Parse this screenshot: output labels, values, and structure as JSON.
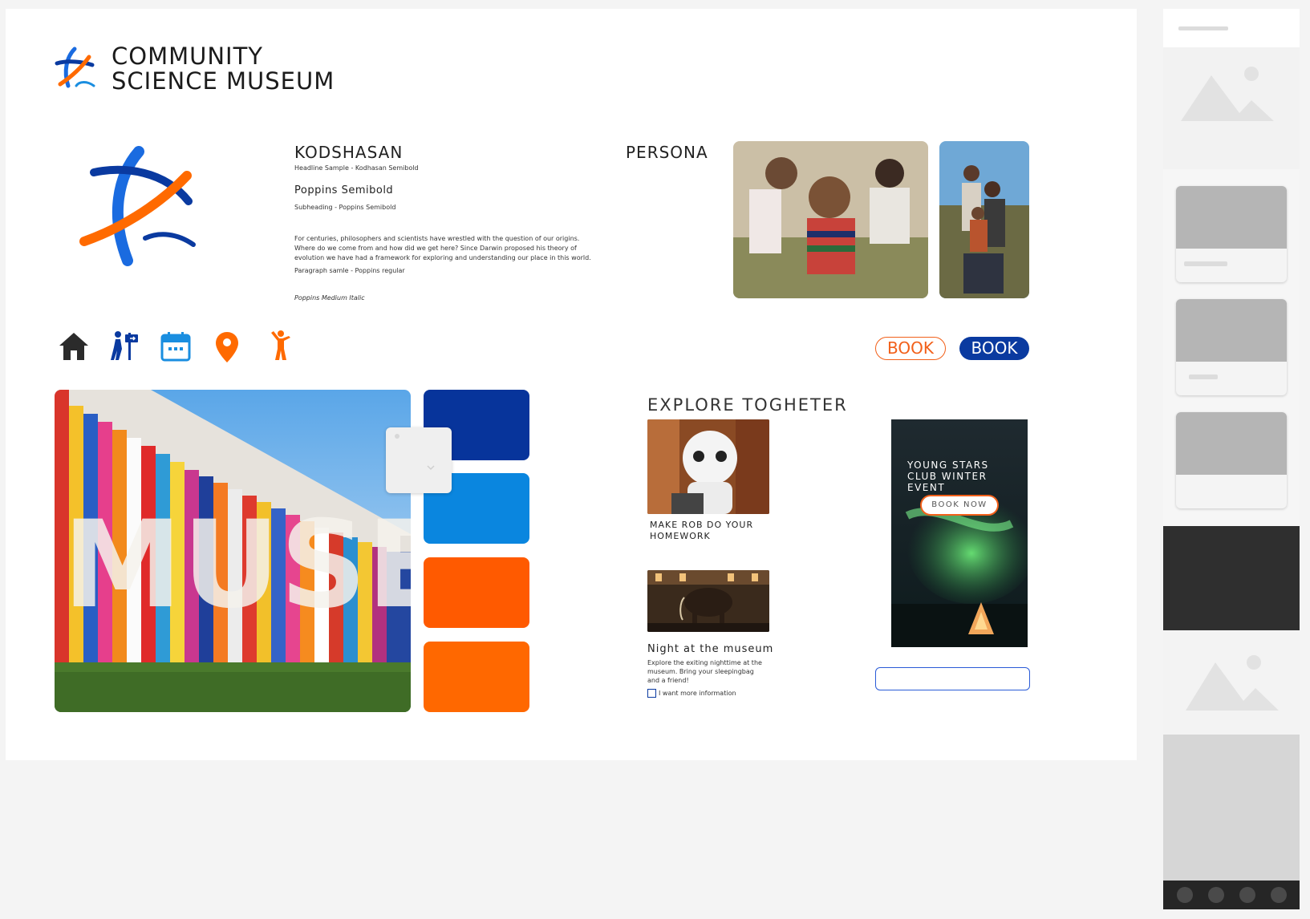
{
  "brand": {
    "name_line1": "COMMUNITY",
    "name_line2": "SCIENCE MUSEUM",
    "colors": {
      "blue_dark": "#0a3aa0",
      "blue_light": "#1a8ee0",
      "orange": "#ff5a00",
      "orange_light": "#ff6a00"
    }
  },
  "typography": {
    "headline": "KODSHASAN",
    "headline_caption": "Headline Sample - Kodhasan Semibold",
    "subheading": "Poppins Semibold",
    "subheading_caption": "Subheading - Poppins Semibold",
    "paragraph": "For centuries, philosophers and scientists have wrestled with the question of our origins. Where do we come from and how did we get here? Since Darwin proposed his theory of evolution we have had a framework for exploring and understanding our place in this world.",
    "paragraph_caption": "Paragraph samle - Poppins regular",
    "italic_caption": "Poppins Medium Italic"
  },
  "persona": {
    "label": "PERSONA"
  },
  "icons": [
    "home-icon",
    "wayfinding-icon",
    "calendar-icon",
    "location-pin-icon",
    "visitor-icon"
  ],
  "buttons": {
    "book_outline": "BOOK",
    "book_solid": "BOOK"
  },
  "hero": {
    "museum_letters": "MUSEUM"
  },
  "palette": [
    "#07349b",
    "#0a86df",
    "#ff5a00",
    "#ff6800"
  ],
  "explore": {
    "title": "EXPLORE TOGHETER",
    "card1_caption": "MAKE ROB DO YOUR HOMEWORK",
    "card2_title": "Night at the museum",
    "card2_desc": "Explore the exiting nighttime at the museum. Bring your sleepingbag and a friend!",
    "checkbox_label": "I want more information"
  },
  "ad": {
    "title": "YOUNG STARS CLUB WINTER EVENT",
    "button": "BOOK NOW"
  }
}
